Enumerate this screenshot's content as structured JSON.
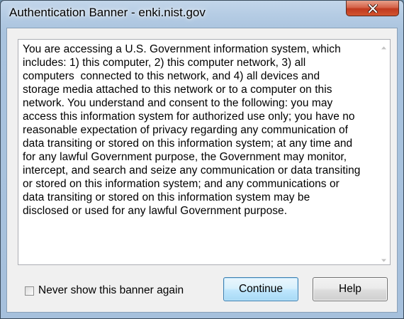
{
  "window": {
    "title": "Authentication Banner - enki.nist.gov"
  },
  "banner": {
    "message": "You are accessing a U.S. Government information system, which\nincludes: 1) this computer, 2) this computer network, 3) all\ncomputers  connected to this network, and 4) all devices and\nstorage media attached to this network or to a computer on this\nnetwork. You understand and consent to the following: you may\naccess this information system for authorized use only; you have no\nreasonable expectation of privacy regarding any communication of\ndata transiting or stored on this information system; at any time and\nfor any lawful Government purpose, the Government may monitor,\nintercept, and search and seize any communication or data transiting\nor stored on this information system; and any communications or\ndata transiting or stored on this information system may be\ndisclosed or used for any lawful Government purpose."
  },
  "options": {
    "never_show_label": "Never show this banner again",
    "never_show_checked": false
  },
  "buttons": {
    "continue_label": "Continue",
    "help_label": "Help"
  },
  "icons": {
    "close": "close-icon",
    "scroll_up": "chevron-up-icon",
    "scroll_down": "chevron-down-icon"
  }
}
